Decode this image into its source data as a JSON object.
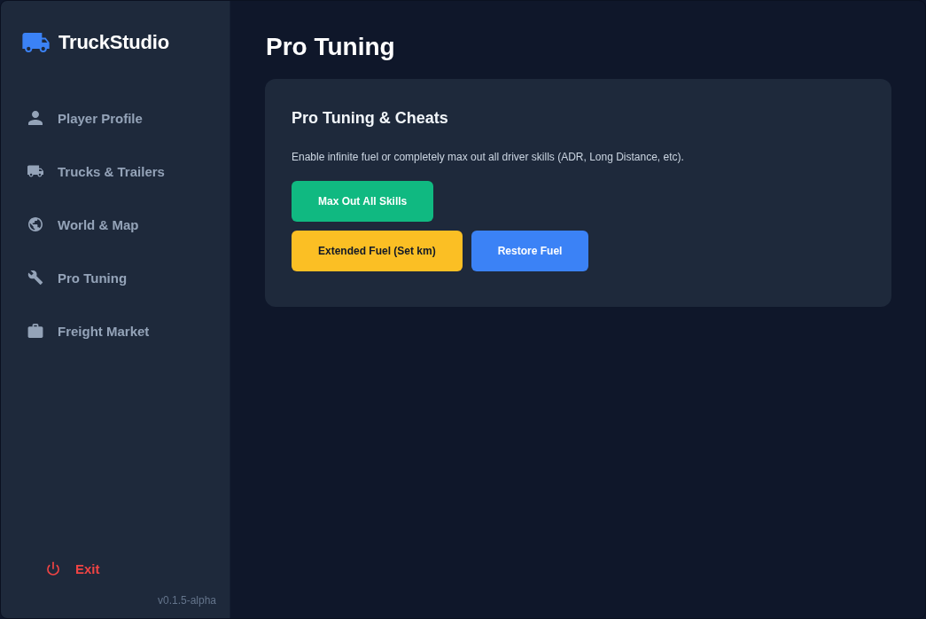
{
  "sidebar": {
    "logo": "TruckStudio",
    "items": [
      {
        "label": "Player Profile"
      },
      {
        "label": "Trucks & Trailers"
      },
      {
        "label": "World & Map"
      },
      {
        "label": "Pro Tuning"
      },
      {
        "label": "Freight Market"
      }
    ],
    "exit": "Exit",
    "version": "v0.1.5-alpha"
  },
  "main": {
    "title": "Pro Tuning",
    "card": {
      "title": "Pro Tuning & Cheats",
      "description": "Enable infinite fuel or completely max out all driver skills (ADR, Long Distance, etc).",
      "button_rows": [
        [
          {
            "label": "Max Out All Skills",
            "color": "#10b981"
          }
        ],
        [
          {
            "label": "Extended Fuel (Set km)",
            "color": "#fbbf24"
          },
          {
            "label": "Restore Fuel",
            "color": "#3b82f6"
          }
        ]
      ]
    }
  }
}
